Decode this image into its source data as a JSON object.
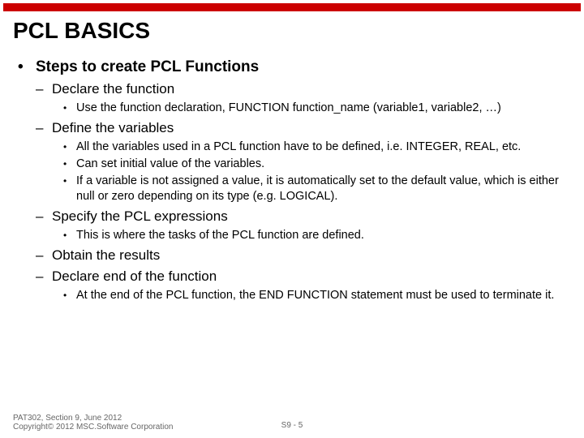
{
  "title": "PCL BASICS",
  "main_bullet": "Steps to create PCL Functions",
  "steps": {
    "declare_fn": {
      "label": "Declare the function",
      "sub1": "Use the function declaration, FUNCTION function_name (variable1, variable2, …)"
    },
    "define_vars": {
      "label": "Define the variables",
      "sub1": "All the variables used in a PCL function have to be defined, i.e. INTEGER, REAL, etc.",
      "sub2": "Can set initial value of the variables.",
      "sub3": "If a variable is not assigned a value, it is automatically set to the default value, which is either null or zero depending on its type (e.g. LOGICAL)."
    },
    "specify_expr": {
      "label": "Specify the PCL expressions",
      "sub1": "This is where the tasks of the PCL function are defined."
    },
    "obtain_results": {
      "label": "Obtain the results"
    },
    "declare_end": {
      "label": "Declare end of the function",
      "sub1": "At the end of the PCL function, the END FUNCTION statement must be used to terminate it."
    }
  },
  "footer": {
    "line1": "PAT302, Section 9, June 2012",
    "line2": "Copyright© 2012 MSC.Software Corporation",
    "pagenum": "S9 - 5"
  }
}
